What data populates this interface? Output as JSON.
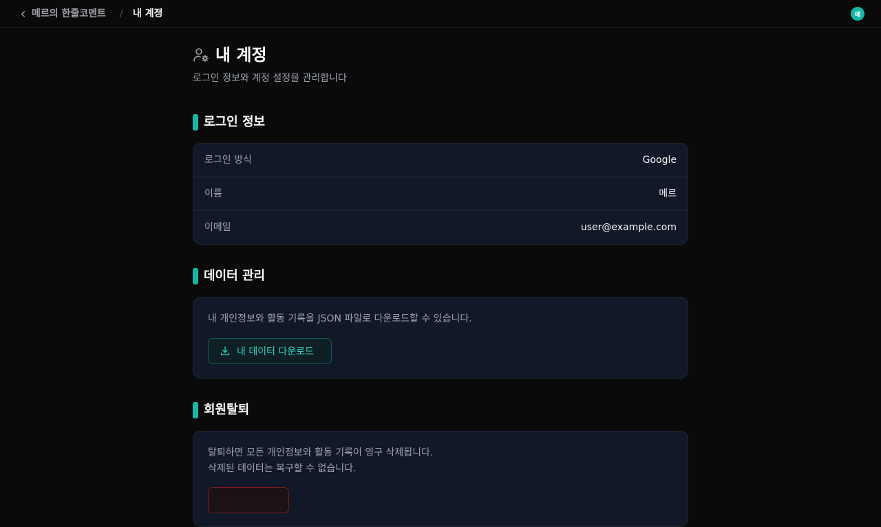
{
  "breadcrumb": {
    "parent": "메르의 한줄코멘트",
    "separator": "/",
    "current": "내 계정"
  },
  "avatar": {
    "initial": "메",
    "color": "#14b8a6"
  },
  "header": {
    "title": "내 계정",
    "subtitle": "로그인 정보와 계정 설정을 관리합니다",
    "icon": "user-gear-icon"
  },
  "login_info": {
    "title": "로그인 정보",
    "rows": [
      {
        "label": "로그인 방식",
        "value": "Google"
      },
      {
        "label": "이름",
        "value": "메르"
      },
      {
        "label": "이메일",
        "value": "user@example.com"
      }
    ]
  },
  "data_management": {
    "title": "데이터 관리",
    "description": "내 개인정보와 활동 기록을 JSON 파일로 다운로드할 수 있습니다.",
    "download_label": "내 데이터 다운로드",
    "download_icon": "download-icon"
  },
  "withdrawal": {
    "title": "회원탈퇴",
    "description_line1": "탈퇴하면 모든 개인정보와 활동 기록이 영구 삭제됩니다.",
    "description_line2": "삭제된 데이터는 복구할 수 없습니다."
  },
  "colors": {
    "accent": "#14b8a6",
    "background": "#0a0a0a",
    "card": "#111827",
    "danger": "#7f1d1d"
  }
}
